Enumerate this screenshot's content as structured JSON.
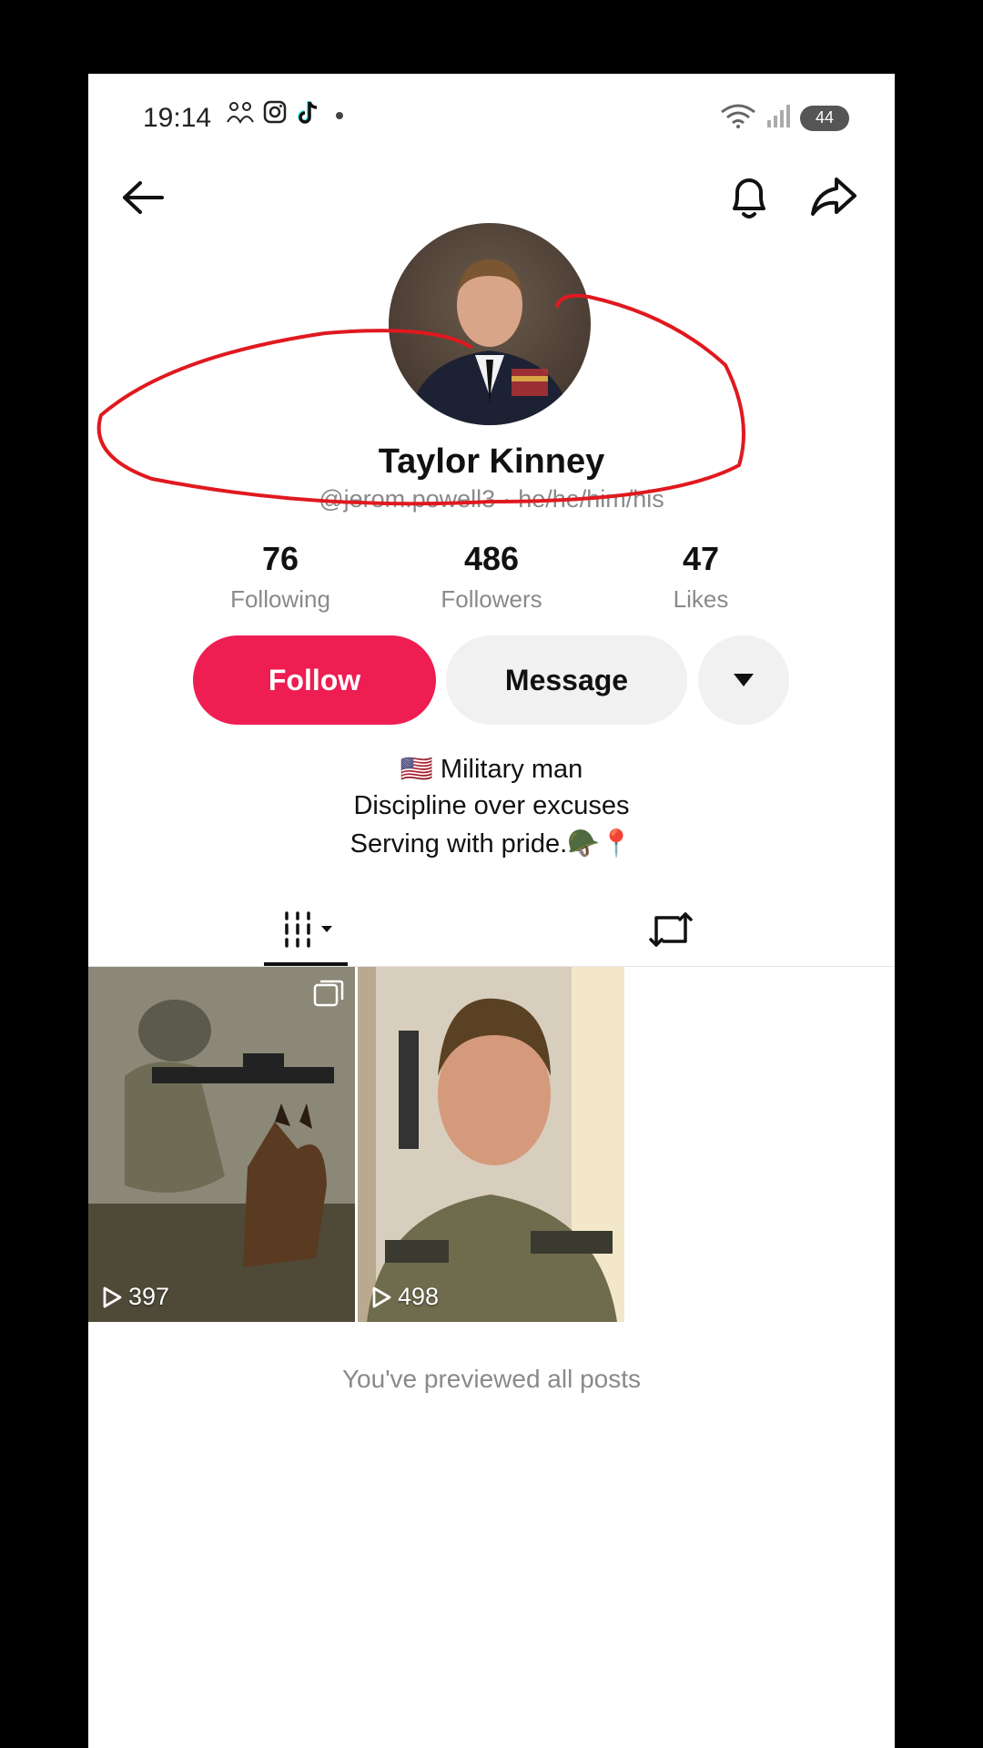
{
  "status_bar": {
    "time": "19:14",
    "notification_icons": [
      "people-icon",
      "instagram-icon",
      "tiktok-icon"
    ],
    "battery": "44"
  },
  "top_bar": {
    "back_icon": "arrow-left-icon",
    "bell_icon": "bell-icon",
    "share_icon": "share-icon"
  },
  "profile": {
    "name": "Taylor Kinney",
    "handle": "@jerom.powell3",
    "separator": "·",
    "pronouns": "he/he/him/his",
    "stats": [
      {
        "value": "76",
        "label": "Following"
      },
      {
        "value": "486",
        "label": "Followers"
      },
      {
        "value": "47",
        "label": "Likes"
      }
    ]
  },
  "actions": {
    "follow_label": "Follow",
    "message_label": "Message",
    "more_icon": "triangle-down-icon"
  },
  "bio": {
    "line1": "🇺🇸 Military man",
    "line2": "Discipline over excuses",
    "line3": "Serving with pride.🪖📍"
  },
  "tabs": {
    "videos_icon": "grid-icon",
    "reposts_icon": "repost-icon"
  },
  "posts": [
    {
      "views": "397"
    },
    {
      "views": "498"
    }
  ],
  "footer_note": "You've previewed all posts",
  "colors": {
    "follow_button": "#ee1d52",
    "annotation": "#e0191f"
  }
}
